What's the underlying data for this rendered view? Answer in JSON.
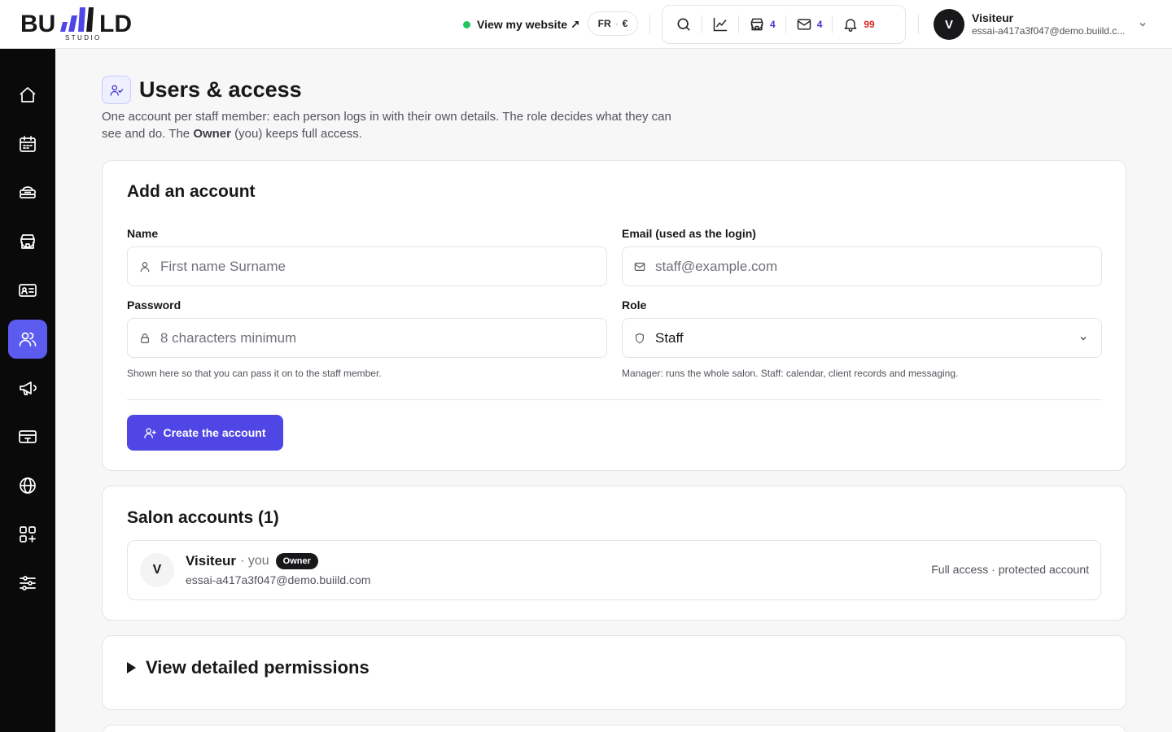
{
  "brand": {
    "name": "BUIILD",
    "sub": "STUDIO"
  },
  "header": {
    "site_link": "View my website ↗",
    "lang": "FR",
    "currency": "€",
    "salons_count": "4",
    "messages_count": "4",
    "notifications_count": "99",
    "user": {
      "initial": "V",
      "name": "Visiteur",
      "email": "essai-a417a3f047@demo.buiild.c..."
    }
  },
  "sidebar": {
    "items": [
      {
        "icon": "home-icon"
      },
      {
        "icon": "calendar-icon"
      },
      {
        "icon": "services-icon"
      },
      {
        "icon": "store-icon"
      },
      {
        "icon": "contact-card-icon"
      },
      {
        "icon": "users-icon",
        "active": true
      },
      {
        "icon": "megaphone-icon"
      },
      {
        "icon": "payment-card-icon"
      },
      {
        "icon": "globe-icon"
      },
      {
        "icon": "apps-icon"
      },
      {
        "icon": "settings-sliders-icon"
      }
    ]
  },
  "page": {
    "title": "Users & access",
    "desc_before": "One account per staff member: each person logs in with their own details. The role decides what they can see and do. The ",
    "desc_bold": "Owner",
    "desc_after": " (you) keeps full access."
  },
  "add_account": {
    "title": "Add an account",
    "name_label": "Name",
    "name_placeholder": "First name Surname",
    "email_label": "Email (used as the login)",
    "email_placeholder": "staff@example.com",
    "password_label": "Password",
    "password_placeholder": "8 characters minimum",
    "password_hint": "Shown here so that you can pass it on to the staff member.",
    "role_label": "Role",
    "role_value": "Staff",
    "role_hint": "Manager: runs the whole salon. Staff: calendar, client records and messaging.",
    "create_button": "Create the account"
  },
  "salon_accounts": {
    "title": "Salon accounts (1)",
    "accounts": [
      {
        "initial": "V",
        "name": "Visiteur",
        "you": "· you",
        "badge": "Owner",
        "email": "essai-a417a3f047@demo.buiild.com",
        "access": "Full access · protected account"
      }
    ]
  },
  "permissions": {
    "label": "View detailed permissions"
  }
}
